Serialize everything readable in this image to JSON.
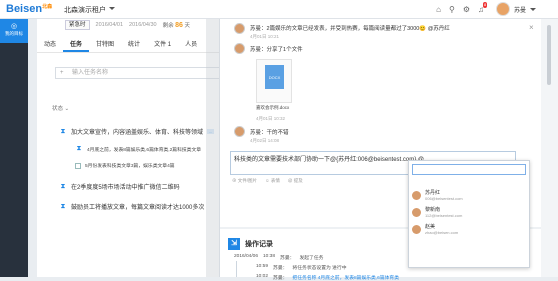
{
  "brand": {
    "name": "Beisen",
    "sub": "北森"
  },
  "topbar": {
    "org": "北森演示租户",
    "badge": "8",
    "user_name": "苏曼"
  },
  "sidebar": {
    "label": "我的目标"
  },
  "left": {
    "emergency_btn": "紧急时",
    "date1": "2016/04/01",
    "date2": "2016/04/30",
    "days_prefix": "剩余",
    "days_value": "86",
    "days_suffix": "天",
    "tabs": [
      "动态",
      "任务",
      "甘特图",
      "统计",
      "文件 1",
      "人员"
    ],
    "search_placeholder": "输入任务名称",
    "status_filter": "状态",
    "tasks": [
      {
        "title": "加大文章宣传，内容涵盖娱乐、体育、科技等领域",
        "tag": "..."
      },
      {
        "title": "4月底之前，发表8篇娱乐类,6篇体育类,2篇科技类文章",
        "sub": true
      },
      {
        "title": "5月份发表科技类文章3篇，娱乐类文章4篇",
        "sub": true
      },
      {
        "title": "在2季度度5场市场活动中推广微信二维码"
      },
      {
        "title": "鼓励员工将播放文章，每篇文章阅读才达1000多次"
      }
    ]
  },
  "right": {
    "close": "×",
    "comments": [
      {
        "author": "苏曼：",
        "text": "2篇娱乐的文章已经发表，并受到热赛，每篇阅读量都过了3000😊 @苏丹红",
        "time": "4月01日 10:21"
      },
      {
        "author": "苏曼：",
        "text": "分享了1个文件",
        "time": "4月01日 10:32"
      },
      {
        "author": "苏曼：",
        "text": "干的不错",
        "time": "4月02日 14:08"
      }
    ],
    "file_name": "嘉欢会示例.docx",
    "file_ext": "DOCX",
    "editor_text": "科技类的文章需要技术部门协助一下@{苏丹红:006@beisentest.com} @",
    "editor_tools": [
      "⊕ 文件/图片",
      "☺ 表情",
      "@ 提及"
    ],
    "op_title": "操作记录",
    "logs": [
      {
        "date": "2016/04/06",
        "time": "10:38",
        "actor": "苏曼：",
        "text": "发起了任务"
      },
      {
        "date": "",
        "time": "10:59",
        "actor": "苏曼：",
        "text": "将任务状态设置为 进行中"
      },
      {
        "date": "",
        "time": "10:02",
        "actor": "苏曼：",
        "text": "把任务名称 4月底之前，发表8篇娱乐类,6篇体育类"
      }
    ]
  },
  "popup": {
    "people": [
      {
        "name": "苏丹红",
        "email": "006@beisentest.com"
      },
      {
        "name": "黎新南",
        "email": "112@beisentest.com"
      },
      {
        "name": "赵美",
        "email": "zhao@beisen.com"
      }
    ]
  },
  "colors": {
    "accent": "#1f87e5",
    "sidebar": "#28313d",
    "days": "#f29c1f"
  }
}
